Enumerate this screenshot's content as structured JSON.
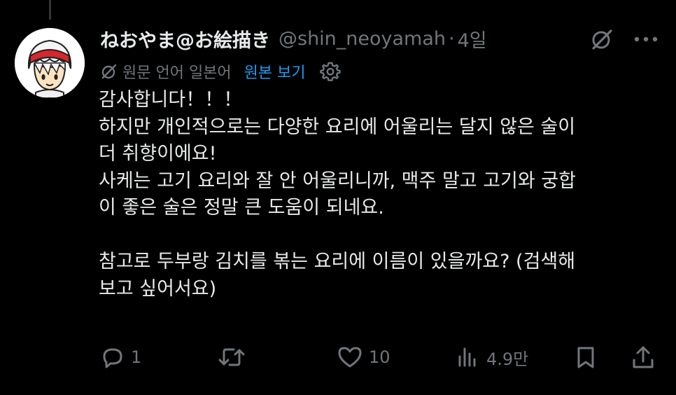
{
  "tweet": {
    "display_name": "ねおやま@お絵描き",
    "handle": "@shin_neoyamah",
    "separator": "·",
    "time": "4일",
    "translation": {
      "language_label": "원문 언어 일본어",
      "show_original_label": "원본 보기"
    },
    "body_lines": [
      "감사합니다！！！",
      "하지만 개인적으로는 다양한 요리에 어울리는 달지 않은 술이",
      "더 취향이에요!",
      "사케는 고기 요리와 잘 안 어울리니까, 맥주 말고 고기와 궁합",
      "이 좋은 술은 정말 큰 도움이 되네요.",
      "참고로 두부랑 김치를 볶는 요리에 이름이 있을까요? (검색해",
      "보고 싶어서요)"
    ],
    "actions": {
      "reply_count": "1",
      "retweet_count": "",
      "like_count": "10",
      "views_count": "4.9만"
    }
  },
  "icons": {
    "avatar": "avatar-illustration",
    "grok": "grok-icon",
    "more": "more-dots-icon",
    "translate": "translate-icon",
    "settings": "gear-icon",
    "reply": "reply-icon",
    "retweet": "retweet-icon",
    "like": "heart-icon",
    "views": "views-icon",
    "bookmark": "bookmark-icon",
    "share": "share-icon"
  },
  "colors": {
    "background": "#000000",
    "text": "#e7e9ea",
    "muted": "#71767b",
    "link": "#1d9bf0"
  }
}
